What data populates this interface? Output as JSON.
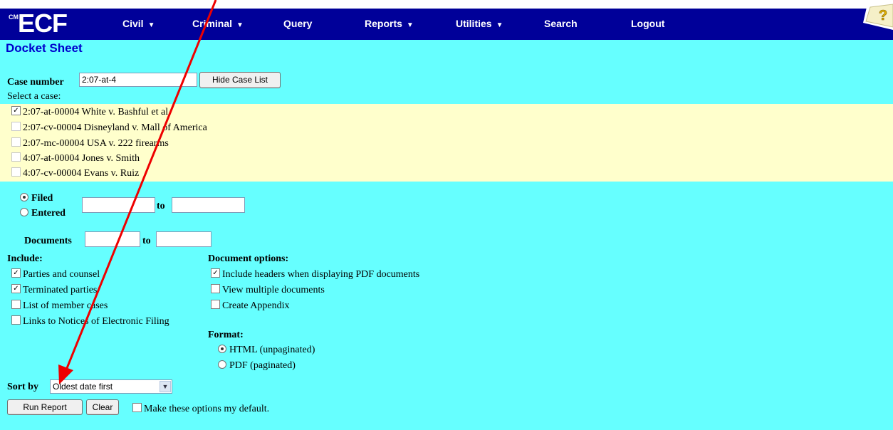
{
  "app": {
    "logo_badge": "CM",
    "logo_text": "ECF"
  },
  "menu": [
    {
      "label": "Civil",
      "dropdown": true
    },
    {
      "label": "Criminal",
      "dropdown": true
    },
    {
      "label": "Query",
      "dropdown": false
    },
    {
      "label": "Reports",
      "dropdown": true
    },
    {
      "label": "Utilities",
      "dropdown": true
    },
    {
      "label": "Search",
      "dropdown": false
    },
    {
      "label": "Logout",
      "dropdown": false
    }
  ],
  "page_title": "Docket Sheet",
  "case_number": {
    "label": "Case number",
    "value": "2:07-at-4",
    "hide_button": "Hide Case List"
  },
  "select_case_label": "Select a case:",
  "cases": [
    {
      "text": "2:07-at-00004 White v. Bashful et al",
      "checked": true
    },
    {
      "text": "2:07-cv-00004 Disneyland v. Mall of America",
      "checked": false
    },
    {
      "text": "2:07-mc-00004 USA v. 222 firearms",
      "checked": false
    },
    {
      "text": "4:07-at-00004 Jones v. Smith",
      "checked": false
    },
    {
      "text": "4:07-cv-00004 Evans v. Ruiz",
      "checked": false
    }
  ],
  "date_filter": {
    "filed_label": "Filed",
    "entered_label": "Entered",
    "selected": "Filed",
    "to_label": "to"
  },
  "documents": {
    "label": "Documents",
    "to_label": "to"
  },
  "include": {
    "heading": "Include:",
    "options": [
      {
        "label": "Parties and counsel",
        "checked": true
      },
      {
        "label": "Terminated parties",
        "checked": true
      },
      {
        "label": "List of member cases",
        "checked": false
      },
      {
        "label": "Links to Notices of Electronic Filing",
        "checked": false
      }
    ]
  },
  "document_options": {
    "heading": "Document options:",
    "options": [
      {
        "label": "Include headers when displaying PDF documents",
        "checked": true
      },
      {
        "label": "View multiple documents",
        "checked": false
      },
      {
        "label": "Create Appendix",
        "checked": false
      }
    ]
  },
  "format": {
    "heading": "Format:",
    "options": [
      {
        "label": "HTML (unpaginated)",
        "selected": true
      },
      {
        "label": "PDF (paginated)",
        "selected": false
      }
    ]
  },
  "sort": {
    "label": "Sort by",
    "value": "Oldest date first"
  },
  "buttons": {
    "run": "Run Report",
    "clear": "Clear"
  },
  "default_option": {
    "label": "Make these options my default.",
    "checked": false
  },
  "colors": {
    "menubar": "#000099",
    "background": "#66ffff",
    "case_list_bg": "#ffffcc",
    "title": "#0000cc",
    "annotation_arrow": "#ee0000"
  }
}
